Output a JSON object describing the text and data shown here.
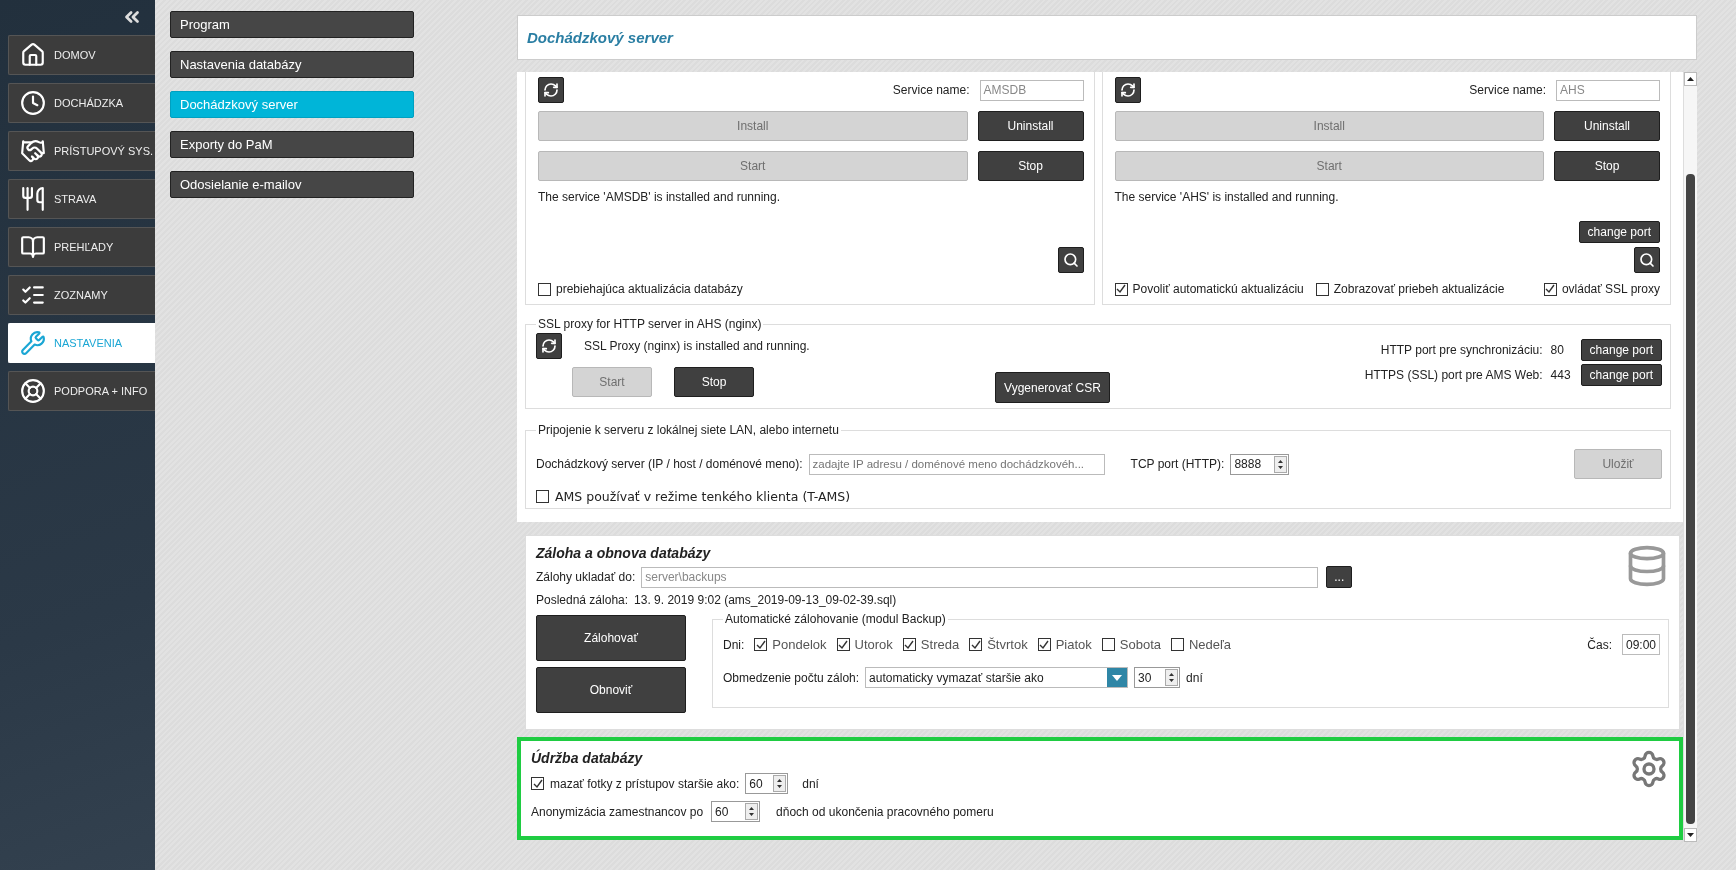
{
  "sidebar": {
    "items": [
      {
        "kind": "home",
        "label": "DOMOV",
        "selected": false
      },
      {
        "kind": "clock",
        "label": "DOCHÁDZKA",
        "selected": false
      },
      {
        "kind": "access",
        "label": "PRÍSTUPOVÝ SYS.",
        "selected": false
      },
      {
        "kind": "food",
        "label": "STRAVA",
        "selected": false
      },
      {
        "kind": "reports",
        "label": "PREHĽADY",
        "selected": false
      },
      {
        "kind": "list",
        "label": "ZOZNAMY",
        "selected": false
      },
      {
        "kind": "settings",
        "label": "NASTAVENIA",
        "selected": true
      },
      {
        "kind": "support",
        "label": "PODPORA + INFO",
        "selected": false
      }
    ]
  },
  "submenu": [
    {
      "label": "Program",
      "selected": false
    },
    {
      "label": "Nastavenia databázy",
      "selected": false
    },
    {
      "label": "Dochádzkový server",
      "selected": true
    },
    {
      "label": "Exporty do PaM",
      "selected": false
    },
    {
      "label": "Odosielanie e-mailov",
      "selected": false
    }
  ],
  "header": {
    "title": "Dochádzkový server"
  },
  "services": [
    {
      "name_label": "Service name:",
      "name_value": "AMSDB",
      "buttons": [
        {
          "label": "Install",
          "disabled": true
        },
        {
          "label": "Uninstall",
          "disabled": false
        },
        {
          "label": "Start",
          "disabled": true
        },
        {
          "label": "Stop",
          "disabled": false
        }
      ],
      "status": "The service 'AMSDB' is installed and running.",
      "checkboxes": [
        {
          "label": "prebiehajúca aktualizácia databázy",
          "checked": false
        }
      ]
    },
    {
      "name_label": "Service name:",
      "name_value": "AHS",
      "buttons": [
        {
          "label": "Install",
          "disabled": true
        },
        {
          "label": "Uninstall",
          "disabled": false
        },
        {
          "label": "Start",
          "disabled": true
        },
        {
          "label": "Stop",
          "disabled": false
        }
      ],
      "status": "The service 'AHS' is installed and running.",
      "change_port": "change port",
      "checkboxes": [
        {
          "label": "Povoliť automatickú aktualizáciu",
          "checked": true
        },
        {
          "label": "Zobrazovať priebeh aktualizácie",
          "checked": false
        },
        {
          "label": "ovládať SSL proxy",
          "checked": true
        }
      ]
    }
  ],
  "ssl_proxy": {
    "legend": "SSL proxy for HTTP server in AHS (nginx)",
    "status": "SSL Proxy (nginx) is installed and running.",
    "buttons": [
      {
        "label": "Start",
        "disabled": true
      },
      {
        "label": "Stop",
        "disabled": false
      }
    ],
    "csr_button": "Vygenerovať CSR",
    "ports": [
      {
        "label": "HTTP port pre synchronizáciu:",
        "value": "80",
        "button": "change port"
      },
      {
        "label": "HTTPS (SSL) port pre AMS Web:",
        "value": "443",
        "button": "change port"
      }
    ]
  },
  "connection": {
    "legend": "Pripojenie k serveru z lokálnej siete LAN, alebo internetu",
    "server_label": "Dochádzkový server (IP / host / doménové meno):",
    "server_placeholder": "zadajte IP adresu / doménové meno dochádzkovéh...",
    "tcp_label": "TCP port (HTTP):",
    "tcp_value": "8888",
    "save_button": {
      "label": "Uložiť",
      "disabled": true
    },
    "thin_client": {
      "label": "AMS používať v režime tenkého klienta (T-AMS)",
      "checked": false
    }
  },
  "backup": {
    "title": "Záloha a obnova databázy",
    "path_label": "Zálohy ukladať do:",
    "path_value": "server\\backups",
    "browse_button": "...",
    "last_label": "Posledná záloha:",
    "last_value": "13. 9. 2019 9:02 (ams_2019-09-13_09-02-39.sql)",
    "actions": [
      "Zálohovať",
      "Obnoviť"
    ],
    "auto": {
      "legend": "Automatické zálohovanie (modul Backup)",
      "days_label": "Dni:",
      "days": [
        {
          "label": "Pondelok",
          "checked": true
        },
        {
          "label": "Utorok",
          "checked": true
        },
        {
          "label": "Streda",
          "checked": true
        },
        {
          "label": "Štvrtok",
          "checked": true
        },
        {
          "label": "Piatok",
          "checked": true
        },
        {
          "label": "Sobota",
          "checked": false
        },
        {
          "label": "Nedeľa",
          "checked": false
        }
      ],
      "time_label": "Čas:",
      "time_value": "09:00",
      "limit_label": "Obmedzenie počtu záloh:",
      "limit_option": "automaticky vymazať staršie ako",
      "limit_value": "30",
      "limit_unit": "dní"
    }
  },
  "maintenance": {
    "title": "Údržba databázy",
    "highlighted": true,
    "photos": {
      "label": "mazať fotky z prístupov staršie ako:",
      "checked": true,
      "value": "60",
      "unit": "dní"
    },
    "anonymize": {
      "label": "Anonymizácia zamestnancov po",
      "value": "60",
      "unit": "dňoch od ukončenia pracovného pomeru"
    }
  }
}
